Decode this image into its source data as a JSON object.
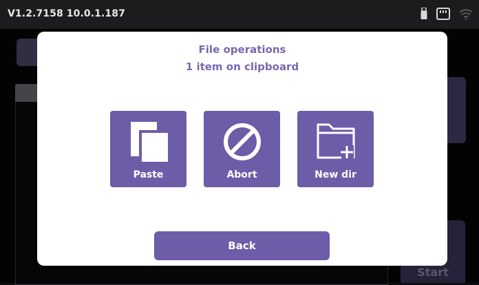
{
  "statusbar": {
    "version": "V1.2.7158  10.0.1.187",
    "icons": [
      "usb-icon",
      "sd-card-icon",
      "wifi-icon"
    ]
  },
  "background": {
    "start_label": "Start"
  },
  "dialog": {
    "title": "File operations",
    "subtitle": "1 item on clipboard",
    "buttons": [
      {
        "label": "Paste",
        "icon": "paste-icon"
      },
      {
        "label": "Abort",
        "icon": "abort-icon"
      },
      {
        "label": "New dir",
        "icon": "new-folder-icon"
      }
    ],
    "back_label": "Back"
  },
  "colors": {
    "accent": "#6d5ca8",
    "title_text": "#7a68b0",
    "dialog_bg": "#ffffff",
    "statusbar_bg": "#1c1c1f"
  }
}
